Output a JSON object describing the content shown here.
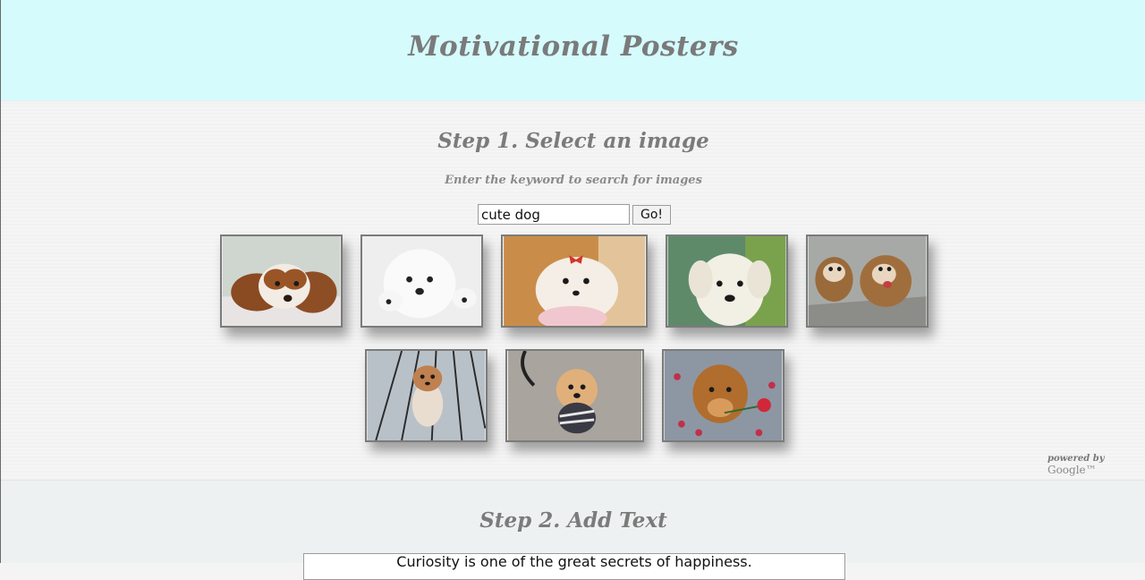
{
  "header": {
    "title": "Motivational Posters"
  },
  "step1": {
    "heading": "Step 1. Select an image",
    "hint": "Enter the keyword to search for images",
    "search_value": "cute dog",
    "go_label": "Go!",
    "powered_by": "powered by",
    "google": "Google™"
  },
  "step2": {
    "heading": "Step 2. Add Text",
    "text_value": "Curiosity is one of the great secrets of happiness."
  },
  "colors": {
    "header_bg": "#d5fbfd",
    "heading_gray": "#7b7b7b"
  }
}
